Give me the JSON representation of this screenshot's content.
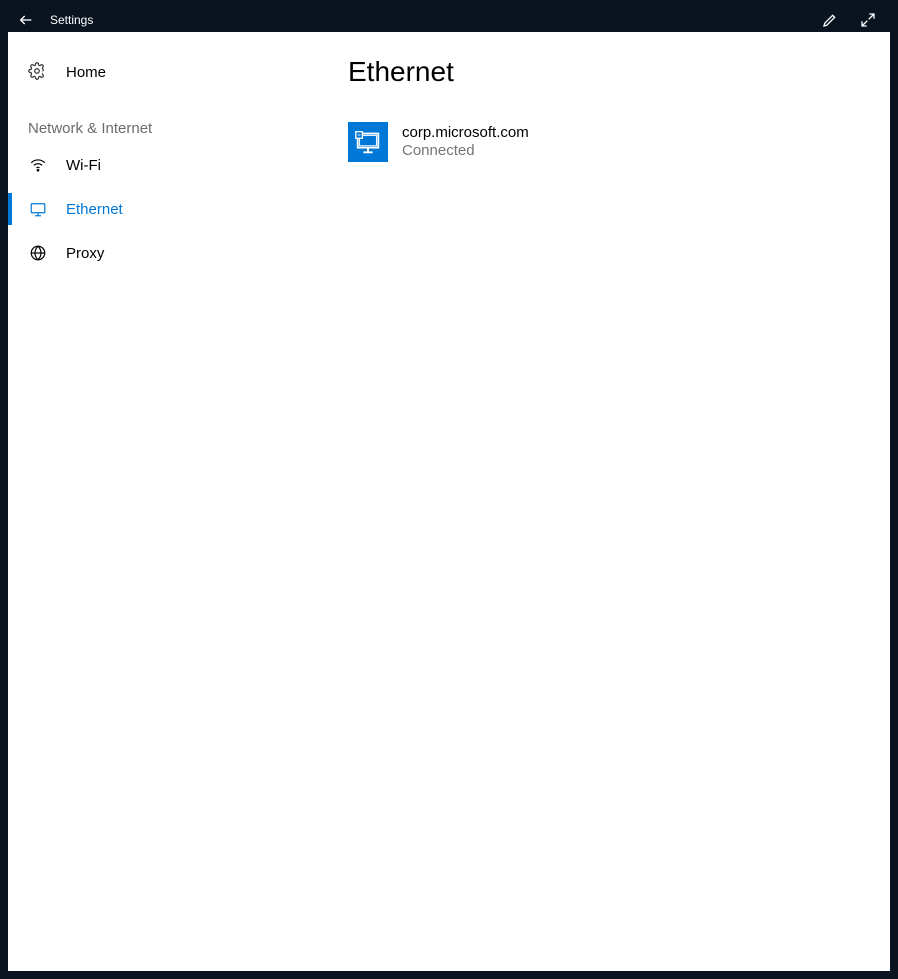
{
  "titlebar": {
    "title": "Settings"
  },
  "sidebar": {
    "home_label": "Home",
    "section_label": "Network & Internet",
    "items": [
      {
        "label": "Wi-Fi"
      },
      {
        "label": "Ethernet"
      },
      {
        "label": "Proxy"
      }
    ]
  },
  "main": {
    "page_title": "Ethernet",
    "connection": {
      "name": "corp.microsoft.com",
      "status": "Connected"
    }
  }
}
